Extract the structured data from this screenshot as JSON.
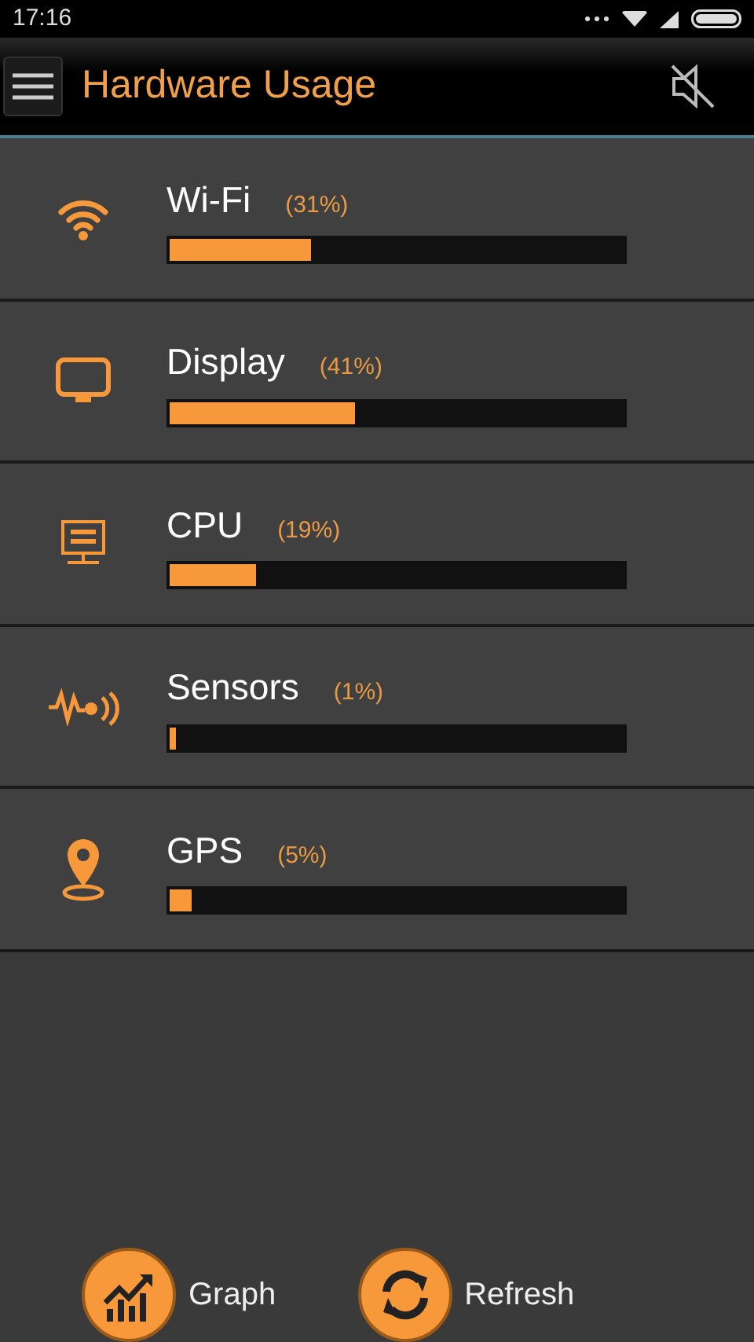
{
  "status_bar": {
    "time": "17:16"
  },
  "app_bar": {
    "title": "Hardware Usage"
  },
  "items": [
    {
      "kind": "wifi",
      "name": "Wi-Fi",
      "reading": "(31%)",
      "level": 0.31
    },
    {
      "kind": "display",
      "name": "Display",
      "reading": "(41%)",
      "level": 0.41
    },
    {
      "kind": "cpu",
      "name": "CPU",
      "reading": "(19%)",
      "level": 0.19
    },
    {
      "kind": "sensors",
      "name": "Sensors",
      "reading": "(1%)",
      "level": 0.01
    },
    {
      "kind": "gps",
      "name": "GPS",
      "reading": "(5%)",
      "level": 0.05
    }
  ],
  "actions": [
    {
      "kind": "graph",
      "label": "Graph"
    },
    {
      "kind": "refresh",
      "label": "Refresh"
    }
  ]
}
